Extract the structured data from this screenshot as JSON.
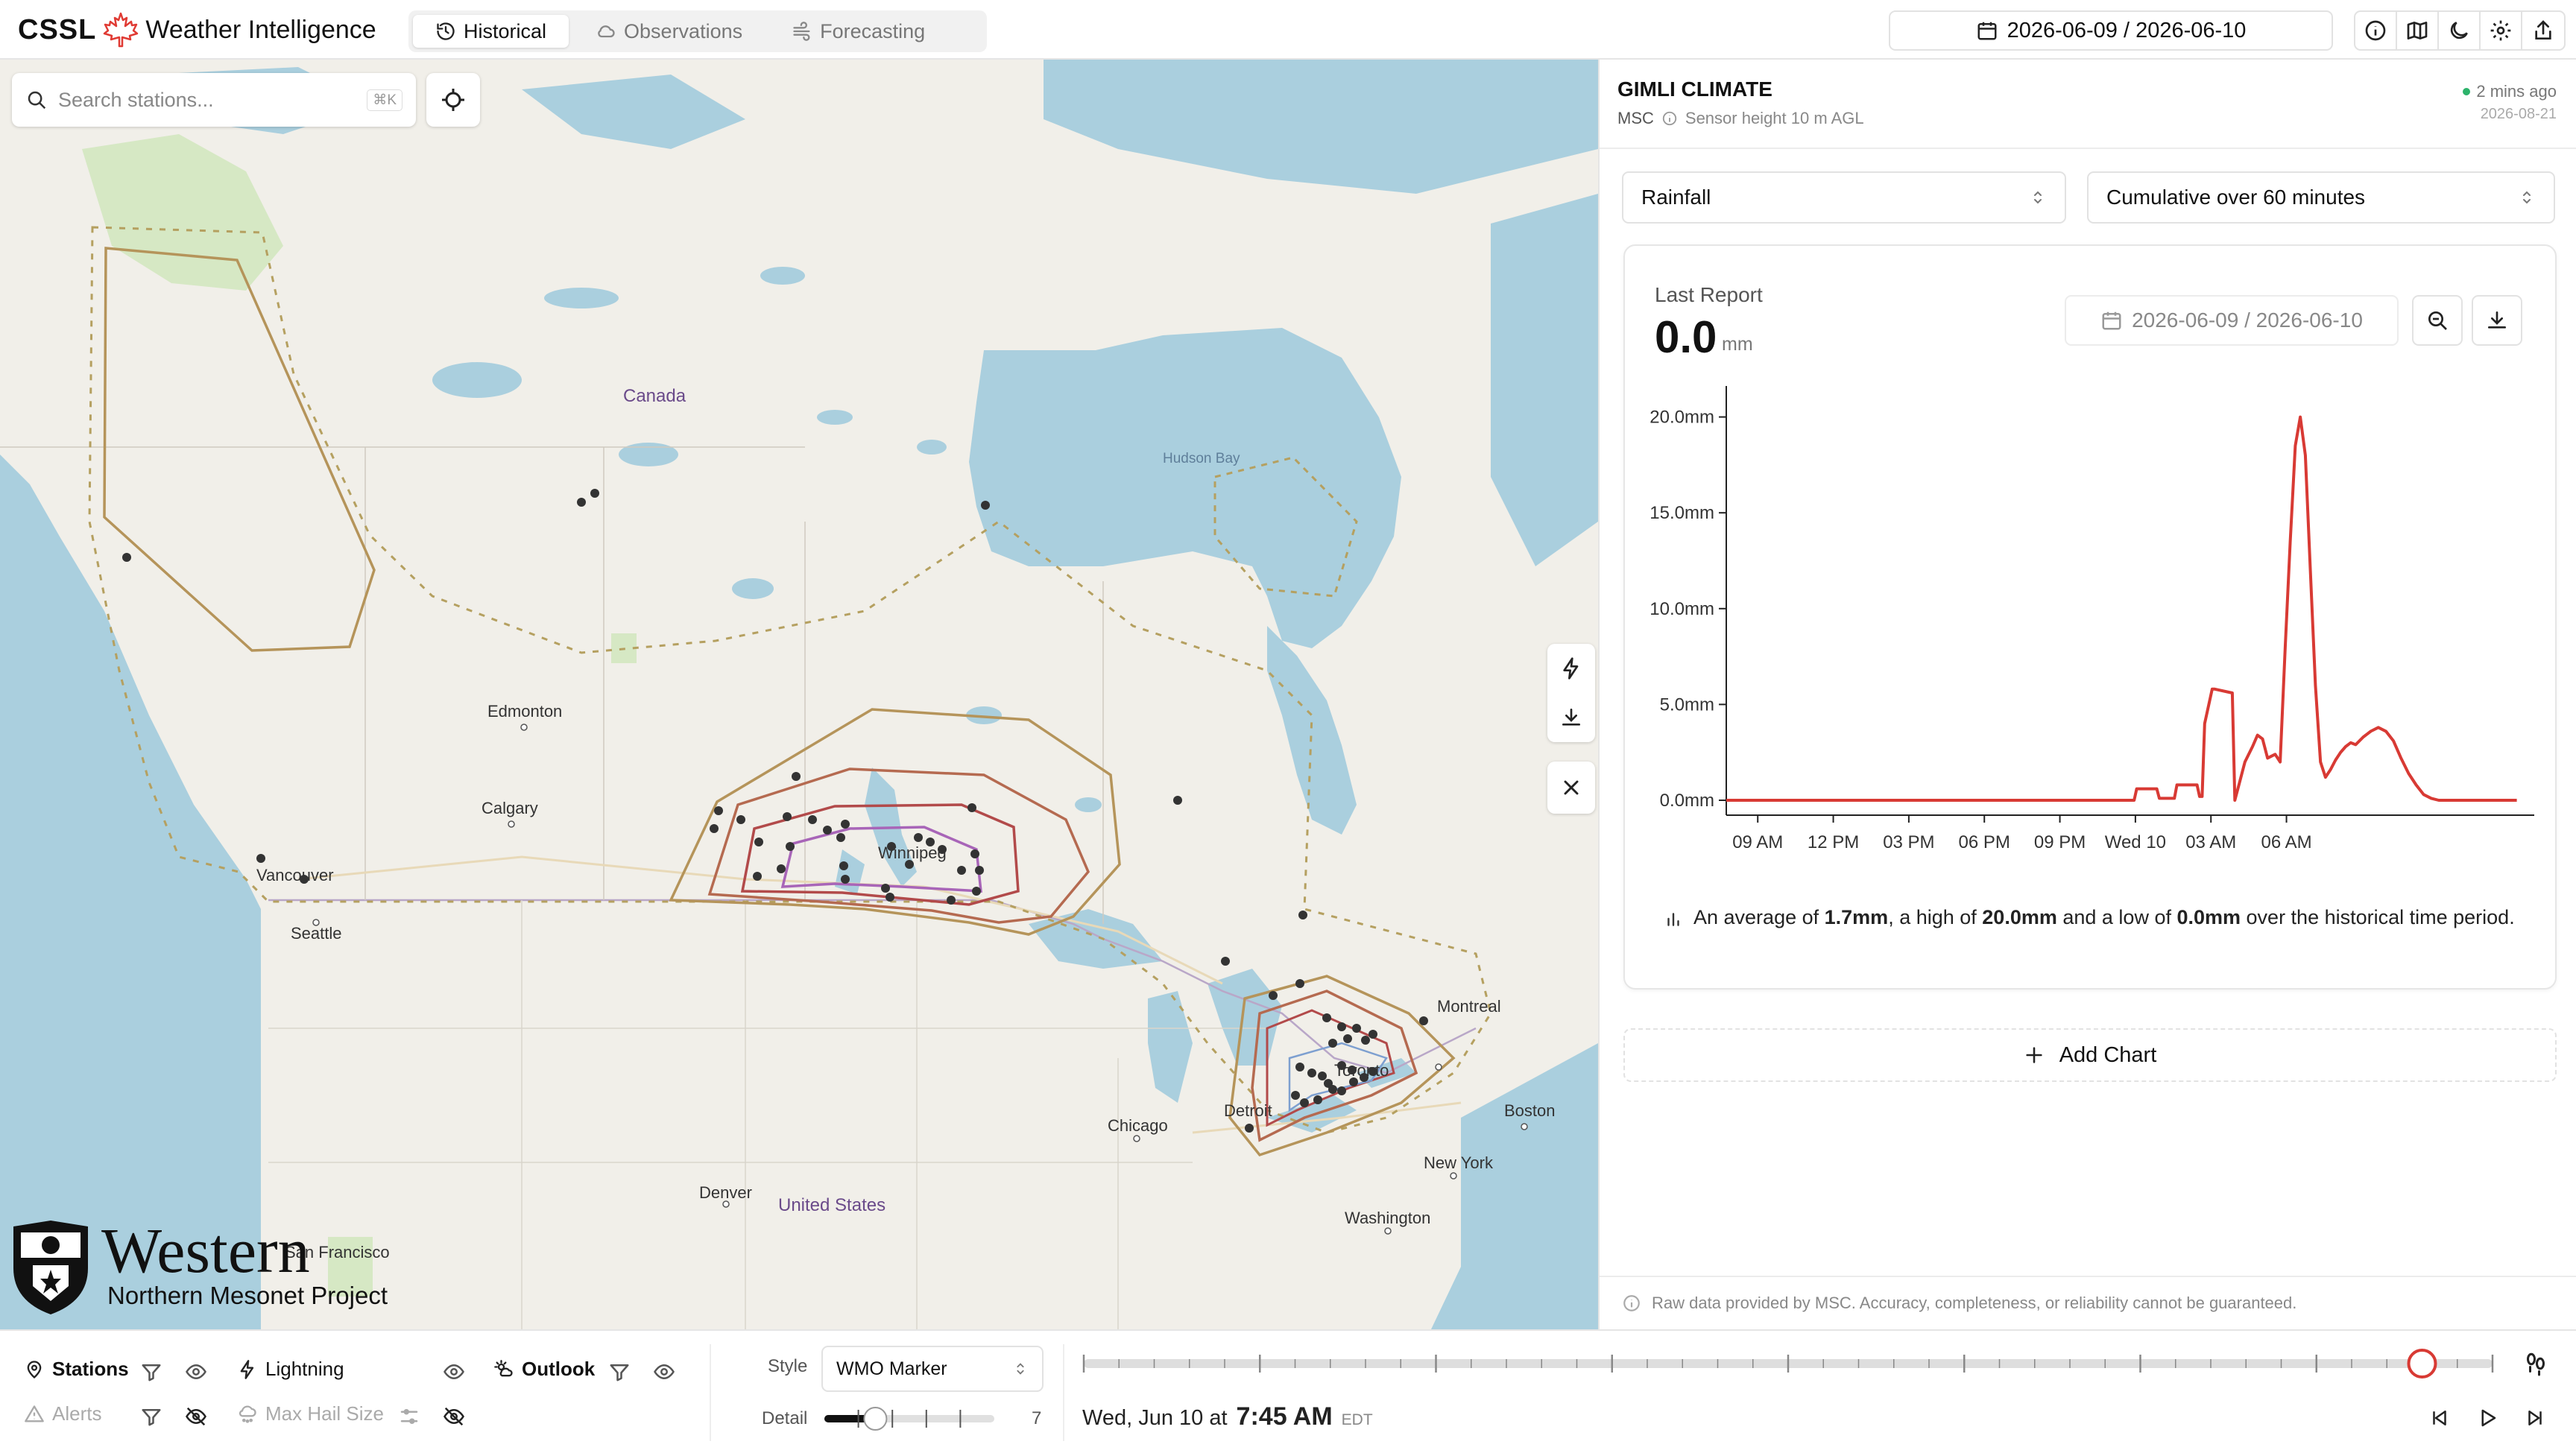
{
  "header": {
    "brand_short": "CSSL",
    "brand_name": "Weather Intelligence",
    "tabs": [
      {
        "label": "Historical",
        "icon": "history-icon",
        "active": true
      },
      {
        "label": "Observations",
        "icon": "cloud-icon",
        "active": false
      },
      {
        "label": "Forecasting",
        "icon": "wind-icon",
        "active": false
      }
    ],
    "date_range": "2026-06-09 / 2026-06-10",
    "action_icons": [
      "info-icon",
      "map-icon",
      "moon-icon",
      "gear-icon",
      "share-icon"
    ]
  },
  "map": {
    "search": {
      "placeholder": "Search stations...",
      "shortcut": "⌘K"
    },
    "labels": {
      "canada": "Canada",
      "hudson_bay": "Hudson Bay",
      "edmonton": "Edmonton",
      "calgary": "Calgary",
      "vancouver": "Vancouver",
      "seattle": "Seattle",
      "winnipeg": "Winnipeg",
      "montreal": "Montreal",
      "toronto": "Toronto",
      "detroit": "Detroit",
      "chicago": "Chicago",
      "boston": "Boston",
      "new_york": "New York",
      "washington": "Washington",
      "denver": "Denver",
      "united_states": "United States",
      "san_francisco": "San Francisco"
    },
    "logo": {
      "title": "Western",
      "subtitle": "Northern Mesonet Project"
    }
  },
  "station": {
    "name": "GIMLI CLIMATE",
    "network": "MSC",
    "sensor": "Sensor height 10 m AGL",
    "updated": "2 mins ago",
    "updated_date": "2026-08-21",
    "variable": "Rainfall",
    "aggregation": "Cumulative over 60 minutes",
    "last_report_label": "Last Report",
    "last_report_value": "0.0",
    "last_report_unit": "mm",
    "chart_range": "2026-06-09 / 2026-06-10",
    "summary": {
      "prefix": "An average of ",
      "avg": "1.7mm",
      "mid1": ", a high of ",
      "high": "20.0mm",
      "mid2": " and a low of ",
      "low": "0.0mm",
      "suffix": " over the historical time period."
    },
    "add_chart": "Add Chart",
    "disclaimer": "Raw data provided by MSC. Accuracy, completeness, or reliability cannot be guaranteed."
  },
  "chart_data": {
    "type": "line",
    "x_ticks": [
      "09 AM",
      "12 PM",
      "03 PM",
      "06 PM",
      "09 PM",
      "Wed 10",
      "03 AM",
      "06 AM"
    ],
    "y_ticks": [
      "0.0mm",
      "5.0mm",
      "10.0mm",
      "15.0mm",
      "20.0mm"
    ],
    "ylim": [
      0,
      20
    ],
    "x_unit": "hours since 2026-06-09 07:45",
    "color": "#d83a34",
    "series": [
      {
        "x": [
          0,
          16.2,
          16.3,
          17.1,
          17.2,
          17.8,
          17.9,
          18.7,
          18.8,
          18.9,
          19.0,
          19.3,
          19.4,
          20.1,
          20.2,
          20.4,
          20.6,
          20.9,
          21.1,
          21.3,
          21.5,
          21.8,
          22.0,
          22.2,
          22.4,
          22.6,
          22.8,
          23.0,
          23.2,
          23.4,
          23.6,
          23.8,
          24.0,
          24.2,
          24.4,
          24.6,
          24.8,
          25.0,
          25.3,
          25.6,
          25.9,
          26.2,
          26.5,
          26.8,
          27.1,
          27.4,
          27.7,
          28.0,
          28.3,
          28.7,
          29.0,
          29.2,
          29.6,
          30.0,
          31.4
        ],
        "y": [
          0,
          0,
          0.6,
          0.6,
          0.1,
          0.1,
          0.8,
          0.8,
          0.2,
          0.2,
          4.0,
          5.8,
          5.8,
          5.6,
          0.0,
          1.0,
          2.0,
          2.8,
          3.4,
          3.2,
          2.2,
          2.4,
          2.0,
          8.0,
          13.5,
          18.5,
          20.0,
          18.0,
          12.0,
          6.0,
          2.0,
          1.2,
          1.6,
          2.1,
          2.5,
          2.8,
          3.0,
          2.9,
          3.3,
          3.6,
          3.8,
          3.6,
          3.1,
          2.2,
          1.4,
          0.8,
          0.3,
          0.1,
          0,
          0,
          0,
          0,
          0,
          0,
          0
        ]
      }
    ]
  },
  "bottom": {
    "layers": {
      "stations": "Stations",
      "lightning": "Lightning",
      "outlook": "Outlook",
      "alerts": "Alerts",
      "max_hail": "Max Hail Size"
    },
    "style_label": "Style",
    "style_value": "WMO Marker",
    "detail_label": "Detail",
    "detail_value": "7",
    "detail_level": 0.3,
    "timeline_position": 0.95,
    "time_prefix": "Wed, Jun 10 at",
    "time_value": "7:45 AM",
    "timezone": "EDT"
  }
}
